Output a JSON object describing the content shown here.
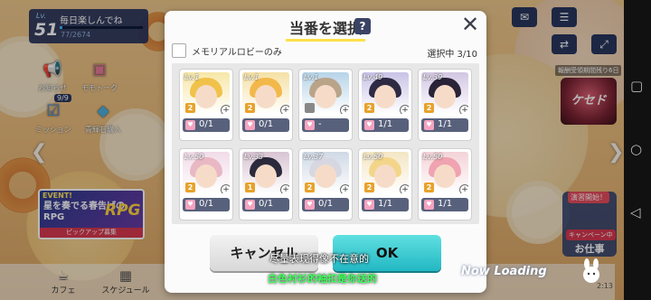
{
  "player": {
    "lv_label": "Lv.",
    "level": "51",
    "name": "毎日楽しんでね",
    "xp": "77/2674",
    "xp_progress": 0.03
  },
  "left_menu": {
    "notice": "お知らせ",
    "momotalk": "モモトーク",
    "mission": "ミッション",
    "mission_count": "9/9",
    "shop": "青輝石購入"
  },
  "event": {
    "tag": "EVENT!",
    "title": "星を奏でる春告げのRPG",
    "rpg": "RPG",
    "pickup": "ピックアップ募集"
  },
  "bottom_bar": [
    "カフェ",
    "スケジュール"
  ],
  "right_side": {
    "boss_info": "報酬受領期間残り6日",
    "boss_name": "ケセド",
    "open_label": "演習開始！",
    "campaign": "キャンペーン中",
    "job": "お仕事",
    "time": "2:13"
  },
  "modal": {
    "title": "当番を選択",
    "help": "?",
    "close": "✕",
    "filter_label": "メモリアルロビーのみ",
    "selected": "選択中 3/10",
    "cancel": "キャンセル",
    "ok": "OK"
  },
  "cards": [
    {
      "lv": "Lv.1",
      "rank": "2",
      "count": "0/1",
      "hair": "#f0c24a",
      "bg": "#f7e7a8",
      "rank_color": "#e8a22a"
    },
    {
      "lv": "Lv.1",
      "rank": "2",
      "count": "0/1",
      "hair": "#f2b84a",
      "bg": "#f5e1a6",
      "rank_color": "#e8a22a"
    },
    {
      "lv": "Lv.1",
      "rank": "",
      "count": "-",
      "hair": "#b9a48a",
      "bg": "#b7d4e8",
      "rank_color": "#888888"
    },
    {
      "lv": "Lv.49",
      "rank": "2",
      "count": "1/1",
      "hair": "#2f2a44",
      "bg": "#c9c3e6",
      "rank_color": "#e8a22a"
    },
    {
      "lv": "Lv.39",
      "rank": "2",
      "count": "1/1",
      "hair": "#2a2338",
      "bg": "#d2c6e2",
      "rank_color": "#e8a22a"
    },
    {
      "lv": "Lv.50",
      "rank": "2",
      "count": "0/1",
      "hair": "#e8b8c4",
      "bg": "#f1dce8",
      "rank_color": "#e8a22a"
    },
    {
      "lv": "Lv.33",
      "rank": "1",
      "count": "0/1",
      "hair": "#2b2a3c",
      "bg": "#d8c4d2",
      "rank_color": "#e8a22a"
    },
    {
      "lv": "Lv.37",
      "rank": "2",
      "count": "0/1",
      "hair": "#d7d7e2",
      "bg": "#cfd9e6",
      "rank_color": "#e8a22a"
    },
    {
      "lv": "Lv.50",
      "rank": "2",
      "count": "1/1",
      "hair": "#f3d58a",
      "bg": "#f4e6c4",
      "rank_color": "#e8a22a"
    },
    {
      "lv": "Lv.50",
      "rank": "2",
      "count": "1/1",
      "hair": "#f0a3b0",
      "bg": "#f3d3d8",
      "rank_color": "#e8a22a"
    }
  ],
  "subtitles": {
    "line1": "尽量表现得像不在意的",
    "line2": "白色衬衫的袖扣是你送的"
  },
  "loading": "Now Loading"
}
